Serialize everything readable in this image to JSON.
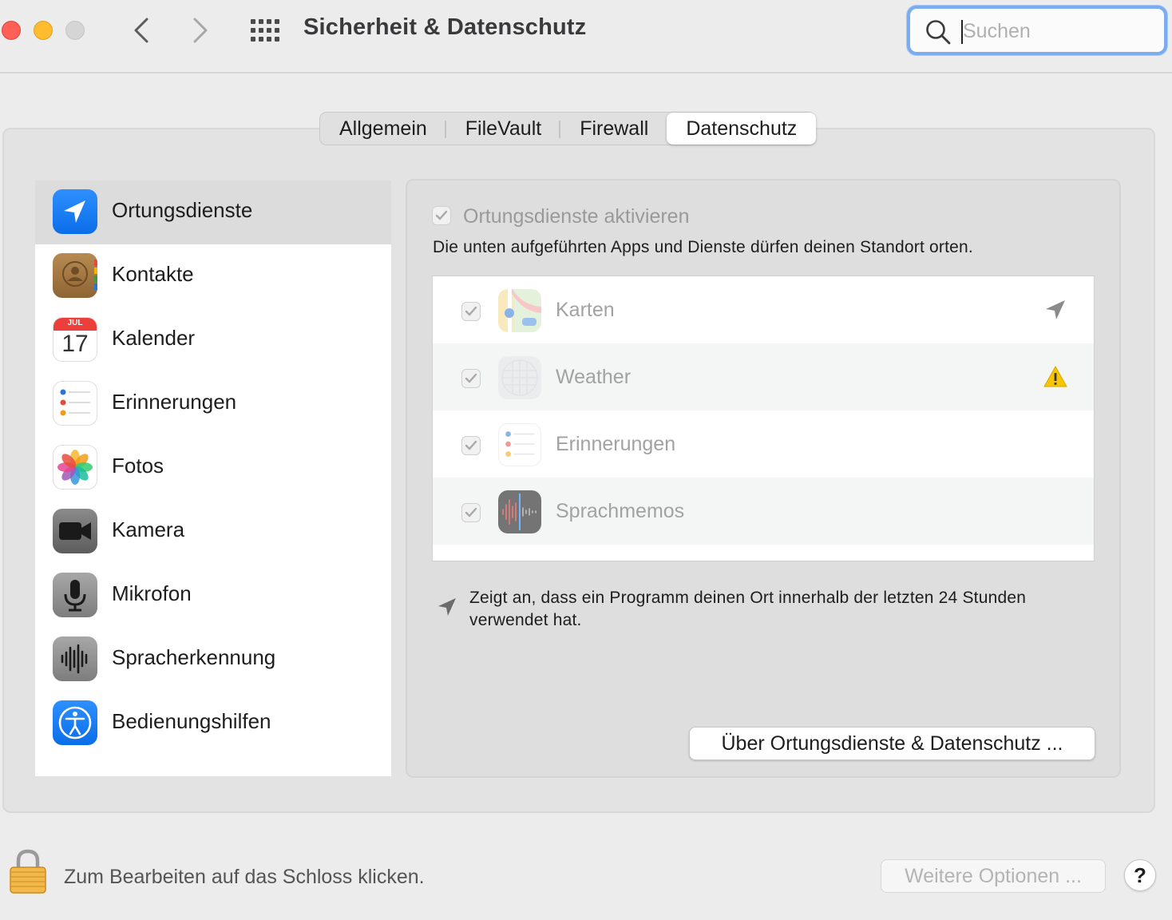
{
  "window": {
    "title": "Sicherheit & Datenschutz",
    "search_placeholder": "Suchen"
  },
  "tabs": [
    {
      "label": "Allgemein",
      "active": false
    },
    {
      "label": "FileVault",
      "active": false
    },
    {
      "label": "Firewall",
      "active": false
    },
    {
      "label": "Datenschutz",
      "active": true
    }
  ],
  "sidebar": {
    "items": [
      {
        "label": "Ortungsdienste",
        "icon": "location-arrow-icon",
        "selected": true
      },
      {
        "label": "Kontakte",
        "icon": "contacts-icon"
      },
      {
        "label": "Kalender",
        "icon": "calendar-icon",
        "month": "JUL",
        "day": "17"
      },
      {
        "label": "Erinnerungen",
        "icon": "reminders-icon"
      },
      {
        "label": "Fotos",
        "icon": "photos-icon"
      },
      {
        "label": "Kamera",
        "icon": "camera-icon"
      },
      {
        "label": "Mikrofon",
        "icon": "microphone-icon"
      },
      {
        "label": "Spracherkennung",
        "icon": "speech-recognition-icon"
      },
      {
        "label": "Bedienungshilfen",
        "icon": "accessibility-icon"
      }
    ]
  },
  "content": {
    "enable_label": "Ortungsdienste aktivieren",
    "enable_checked": true,
    "description": "Die unten aufgeführten Apps und Dienste dürfen deinen Standort orten.",
    "apps": [
      {
        "name": "Karten",
        "checked": true,
        "icon": "maps-icon",
        "status": "location-arrow-icon"
      },
      {
        "name": "Weather",
        "checked": true,
        "icon": "weather-icon",
        "status": "warning-icon"
      },
      {
        "name": "Erinnerungen",
        "checked": true,
        "icon": "reminders-icon",
        "status": ""
      },
      {
        "name": "Sprachmemos",
        "checked": true,
        "icon": "voice-memos-icon",
        "status": ""
      }
    ],
    "legend": "Zeigt an, dass ein Programm deinen Ort innerhalb der letzten 24 Stunden verwendet hat.",
    "about_button": "Über Ortungsdienste & Datenschutz ..."
  },
  "footer": {
    "lock_text": "Zum Bearbeiten auf das Schloss klicken.",
    "more_button": "Weitere Optionen ...",
    "help_button": "?"
  },
  "colors": {
    "accent": "#1a7cf5",
    "warning": "#f7c600",
    "selected_row": "#dcdcdc"
  }
}
